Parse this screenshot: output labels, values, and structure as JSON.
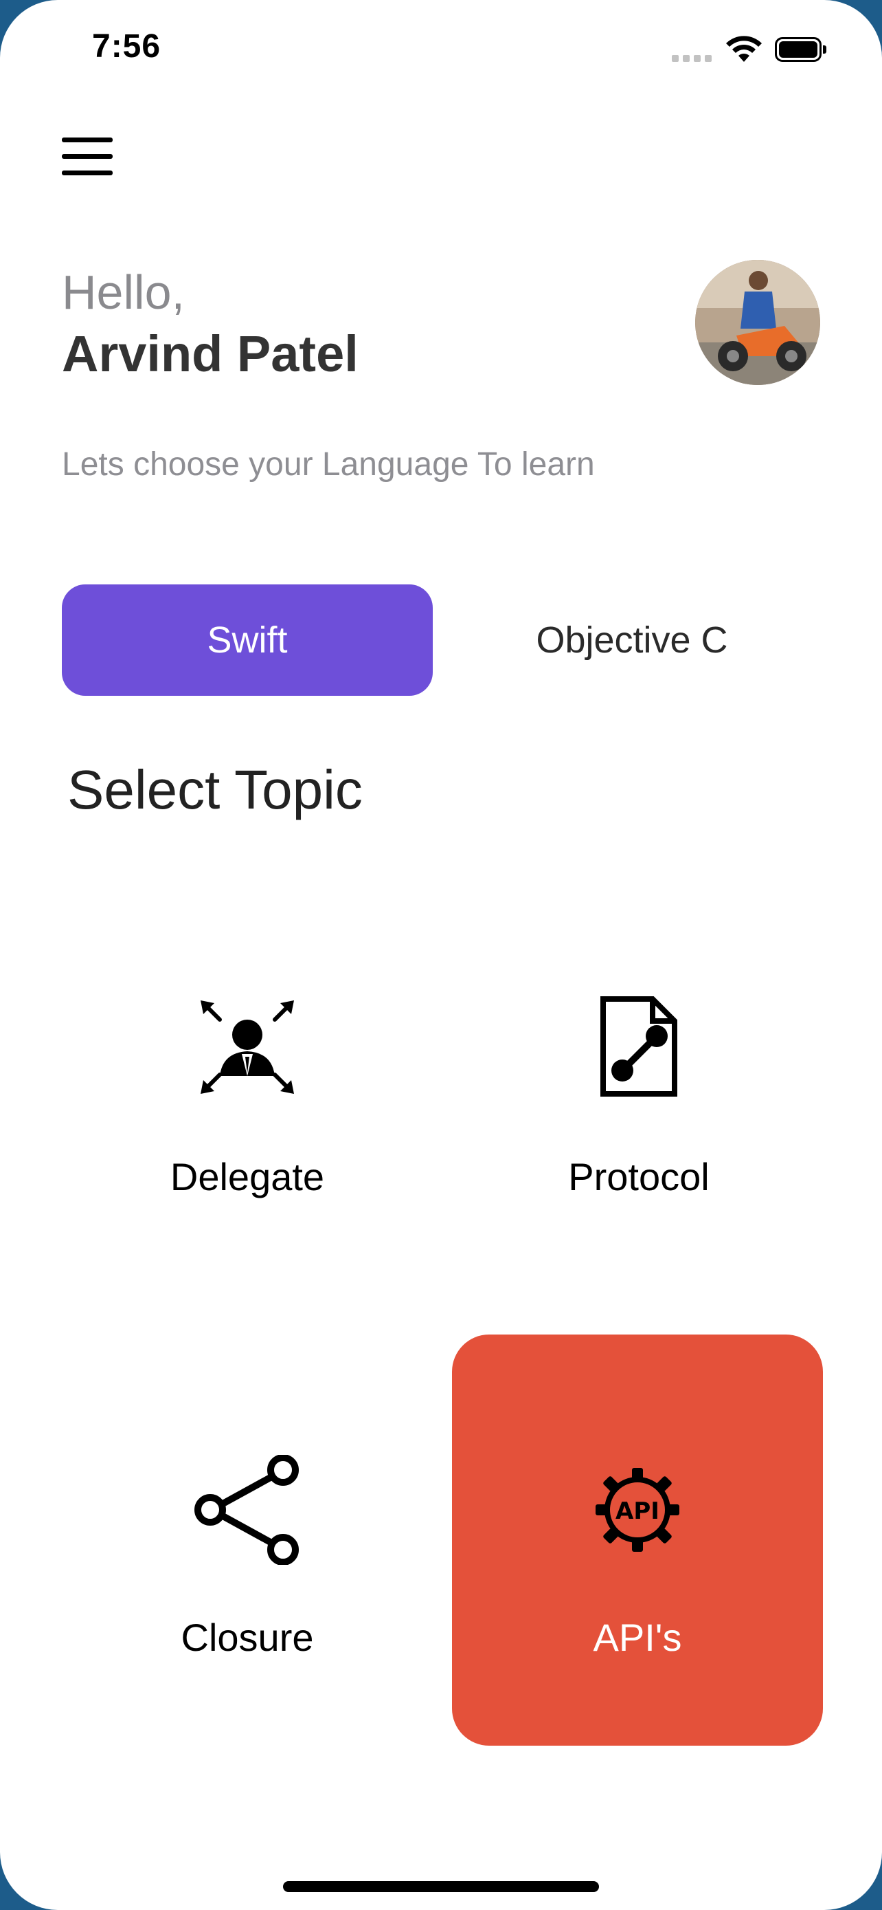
{
  "status_bar": {
    "time": "7:56"
  },
  "greeting": {
    "hello": "Hello,",
    "name": "Arvind Patel",
    "subtitle": "Lets choose your Language To learn"
  },
  "languages": {
    "selected": "Swift",
    "options": [
      "Swift",
      "Objective C"
    ]
  },
  "topics": {
    "title": "Select Topic",
    "items": [
      {
        "label": "Delegate",
        "icon": "delegate-icon"
      },
      {
        "label": "Protocol",
        "icon": "protocol-icon"
      },
      {
        "label": "Closure",
        "icon": "share-icon"
      },
      {
        "label": "API's",
        "icon": "api-gear-icon"
      }
    ],
    "active": "API's"
  },
  "colors": {
    "accent_purple": "#6E4FD9",
    "active_card": "#E4513A",
    "muted_text": "#8E8E93"
  }
}
